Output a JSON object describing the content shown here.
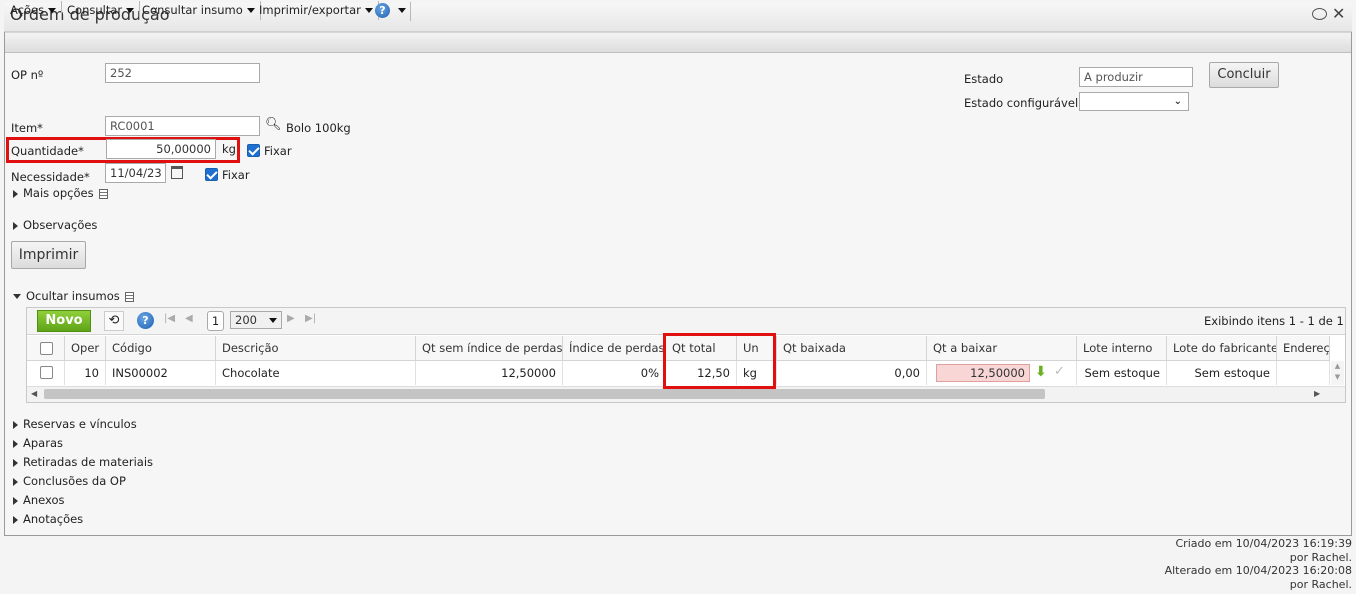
{
  "window": {
    "title": "Ordem de produção"
  },
  "toolbar": {
    "acoes": "Ações",
    "consultar": "Consultar",
    "consultar_insumo": "Consultar insumo",
    "imprimir_exportar": "Imprimir/exportar",
    "help": "?"
  },
  "form": {
    "op_label": "OP nº",
    "op_value": "252",
    "estado_label": "Estado",
    "estado_value": "A produzir",
    "estado_config_label": "Estado configurável",
    "estado_config_value": "",
    "concluir": "Concluir",
    "item_label": "Item*",
    "item_value": "RC0001",
    "item_desc": "Bolo 100kg",
    "quantidade_label": "Quantidade*",
    "quantidade_value": "50,00000",
    "quantidade_unit": "kg",
    "fixar": "Fixar",
    "necessidade_label": "Necessidade*",
    "necessidade_value": "11/04/23",
    "mais_opcoes": "Mais opções",
    "observacoes": "Observações",
    "imprimir": "Imprimir"
  },
  "insumos": {
    "toggle": "Ocultar insumos",
    "novo": "Novo",
    "page": "1",
    "page_size": "200",
    "exibindo": "Exibindo itens 1 - 1 de 1",
    "columns": [
      "Oper",
      "Código",
      "Descrição",
      "Qt sem índice de perdas",
      "Índice de perdas",
      "Qt total",
      "Un",
      "Qt baixada",
      "Qt a baixar",
      "Lote interno",
      "Lote do fabricante",
      "Endereç"
    ],
    "rows": [
      {
        "oper": "10",
        "codigo": "INS00002",
        "descricao": "Chocolate",
        "qt_sem": "12,50000",
        "indice": "0%",
        "qt_total": "12,50",
        "un": "kg",
        "qt_baixada": "0,00",
        "qt_a_baixar": "12,50000",
        "lote_interno": "Sem estoque",
        "lote_fabricante": "Sem estoque",
        "endereco": ""
      }
    ]
  },
  "sections": [
    "Reservas e vínculos",
    "Aparas",
    "Retiradas de materiais",
    "Conclusões da OP",
    "Anexos",
    "Anotações"
  ],
  "footer": {
    "criado": "Criado em 10/04/2023 16:19:39",
    "criado_por": "por Rachel.",
    "alterado": "Alterado em 10/04/2023 16:20:08",
    "alterado_por": "por Rachel."
  },
  "colors": {
    "accent_green": "#6ab023",
    "highlight_red": "#e01010",
    "pending_pink": "#f9d6d6"
  }
}
